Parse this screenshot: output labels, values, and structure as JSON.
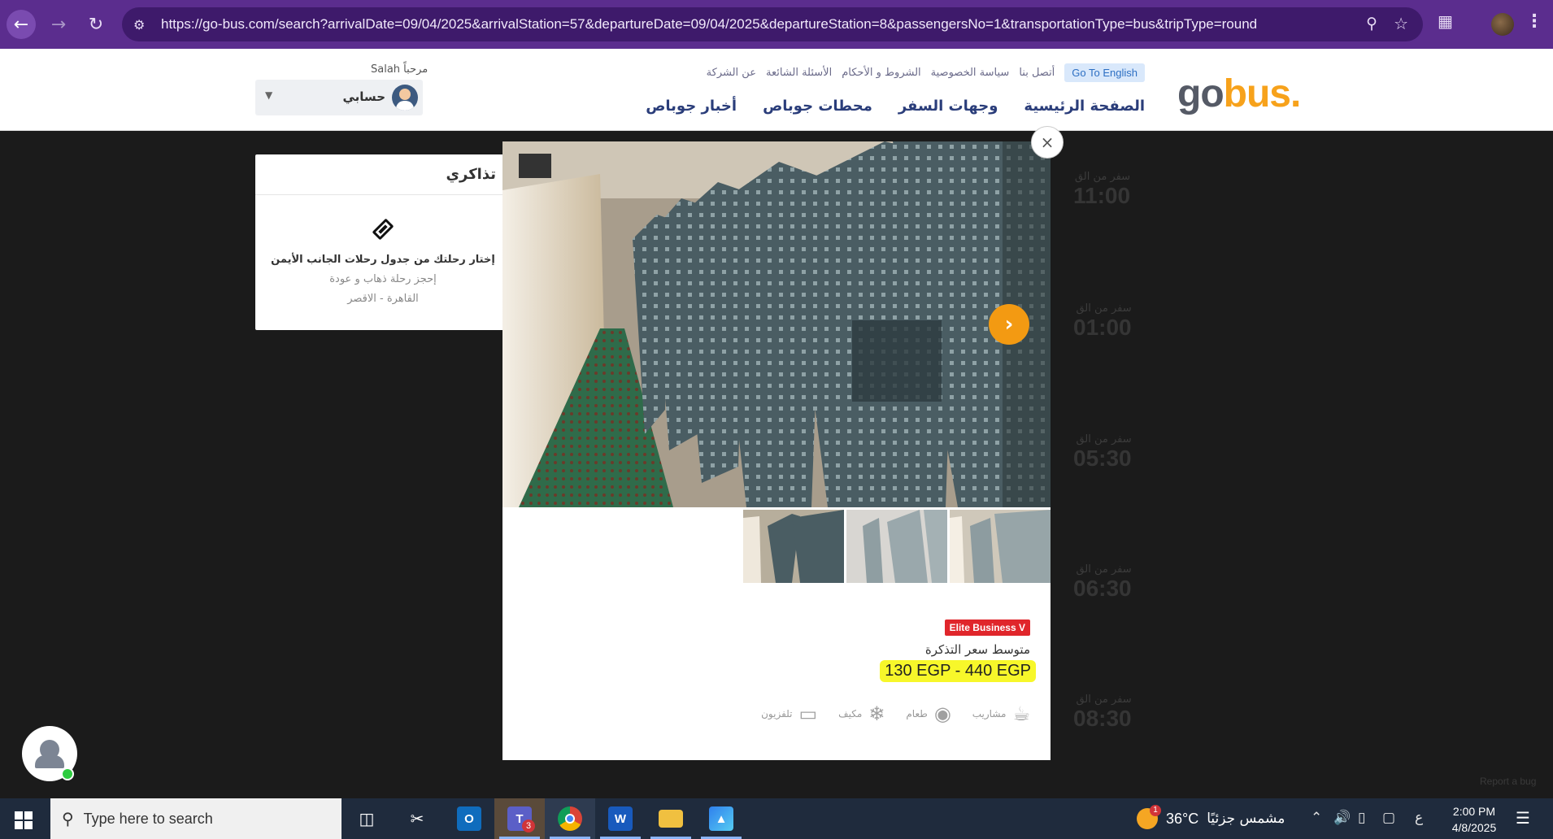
{
  "browser": {
    "url": "https://go-bus.com/search?arrivalDate=09/04/2025&arrivalStation=57&departureDate=09/04/2025&departureStation=8&passengersNo=1&transportationType=bus&tripType=round",
    "icons": [
      "back-arrow-icon",
      "forward-arrow-icon",
      "reload-icon",
      "site-settings-icon",
      "zoom-icon",
      "bookmark-star-icon",
      "extensions-icon",
      "profile-avatar",
      "kebab-menu-icon"
    ]
  },
  "header": {
    "logo_go": "go",
    "logo_bus": "bus.",
    "top_links": [
      "عن الشركة",
      "الأسئلة الشائعة",
      "الشروط و الأحكام",
      "سياسة الخصوصية",
      "أتصل بنا",
      "Go To English"
    ],
    "nav": [
      "الصفحة الرئيسية",
      "وجهات السفر",
      "محطات جوباص",
      "أخبار جوباص"
    ],
    "welcome": "مرحباً Salah",
    "account_label": "حسابي"
  },
  "background_trips": [
    {
      "label": "سفر من الق",
      "time": "11:00"
    },
    {
      "label": "سفر من الق",
      "time": "01:00"
    },
    {
      "label": "سفر من الق",
      "time": "05:30"
    },
    {
      "label": "سفر من الق",
      "time": "06:30"
    },
    {
      "label": "سفر من الق",
      "time": "08:30"
    }
  ],
  "report_bug": "Report a bug",
  "tickets": {
    "title": "تذاكري",
    "main": "إختار رحلتك من جدول رحلات الجانب الأيمن",
    "sub1": "إحجز رحلة ذهاب و عودة",
    "sub2": "القاهرة - الاقصر"
  },
  "modal": {
    "close": "×",
    "next": "›",
    "badge": "Elite Business V",
    "avg_label": "متوسط سعر التذكرة",
    "price": "130 EGP - 440 EGP",
    "amenities": [
      {
        "icon": "coffee-cup-icon",
        "label": "مشاريب"
      },
      {
        "icon": "food-cloche-icon",
        "label": "طعام"
      },
      {
        "icon": "snowflake-icon",
        "label": "مكيف"
      },
      {
        "icon": "tv-icon",
        "label": "تلفزيون"
      }
    ]
  },
  "taskbar": {
    "search_placeholder": "Type here to search",
    "apps": [
      "task-view",
      "snipping-tool",
      "outlook",
      "teams",
      "chrome",
      "word",
      "file-explorer",
      "photos"
    ],
    "teams_badge": "3",
    "weather_badge": "1",
    "weather_temp": "36°C",
    "weather_desc": "مشمس جزئيًا",
    "input_lang": "ع",
    "time": "2:00 PM",
    "date": "4/8/2025"
  }
}
